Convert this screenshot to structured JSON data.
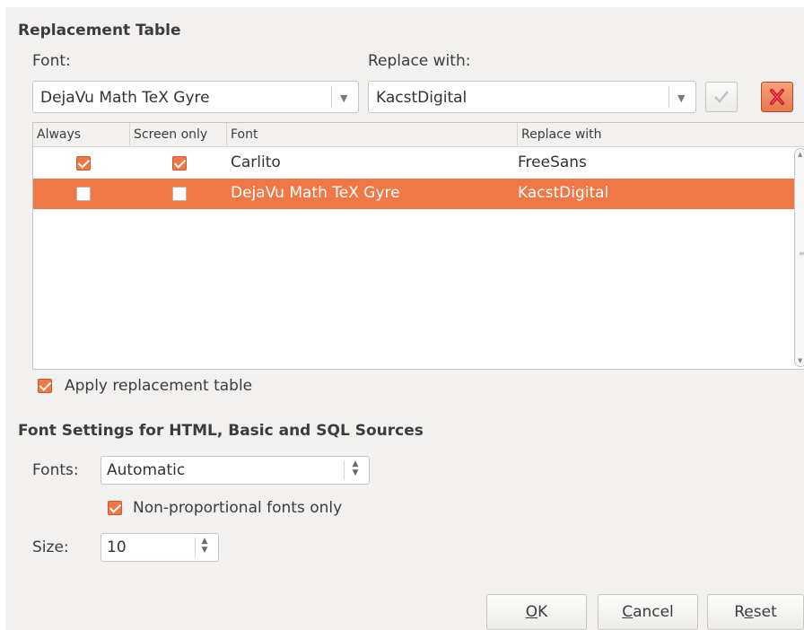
{
  "replacement": {
    "heading": "Replacement Table",
    "font_label": "Font:",
    "replace_label": "Replace with:",
    "font_value": "DejaVu Math TeX Gyre",
    "replace_value": "KacstDigital",
    "columns": [
      "Always",
      "Screen only",
      "Font",
      "Replace with"
    ],
    "rows": [
      {
        "always": true,
        "screen_only": true,
        "font": "Carlito",
        "replace": "FreeSans",
        "selected": false
      },
      {
        "always": false,
        "screen_only": false,
        "font": "DejaVu Math TeX Gyre",
        "replace": "KacstDigital",
        "selected": true
      }
    ],
    "apply_label": "Apply replacement table",
    "apply_checked": true
  },
  "source_fonts": {
    "heading": "Font Settings for HTML, Basic and SQL Sources",
    "fonts_label": "Fonts:",
    "fonts_value": "Automatic",
    "nonprop_label": "Non-proportional fonts only",
    "nonprop_checked": true,
    "size_label": "Size:",
    "size_value": "10"
  },
  "buttons": {
    "ok_mn": "O",
    "ok_rest": "K",
    "cancel_mn": "C",
    "cancel_rest": "ancel",
    "reset_pre": "R",
    "reset_mn": "e",
    "reset_rest": "set"
  },
  "colors": {
    "accent": "#f07746",
    "panel": "#f2f1f0"
  },
  "icons": [
    "dropdown-arrow-icon",
    "apply-check-icon",
    "delete-icon",
    "checkbox-check-icon",
    "spin-updown-icon"
  ]
}
